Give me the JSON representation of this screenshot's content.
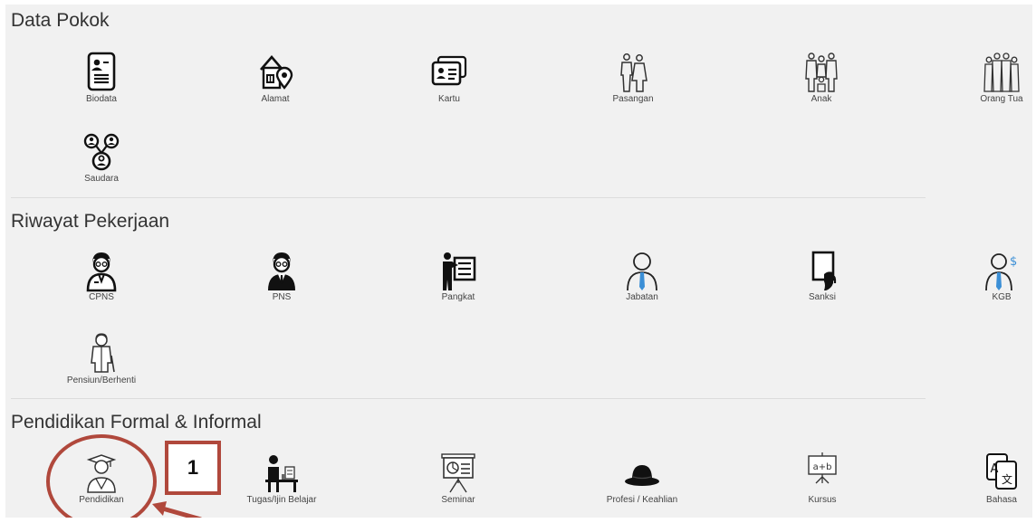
{
  "sections": [
    {
      "title": "Data Pokok",
      "items": [
        {
          "label": "Biodata",
          "icon": "id-card-icon"
        },
        {
          "label": "Alamat",
          "icon": "house-location-icon"
        },
        {
          "label": "Kartu",
          "icon": "card-icon"
        },
        {
          "label": "Pasangan",
          "icon": "couple-icon"
        },
        {
          "label": "Anak",
          "icon": "family-children-icon"
        },
        {
          "label": "Orang Tua",
          "icon": "parents-family-icon"
        },
        {
          "label": "Saudara",
          "icon": "siblings-network-icon"
        }
      ]
    },
    {
      "title": "Riwayat Pekerjaan",
      "items": [
        {
          "label": "CPNS",
          "icon": "civil-servant-candidate-icon"
        },
        {
          "label": "PNS",
          "icon": "civil-servant-icon"
        },
        {
          "label": "Pangkat",
          "icon": "presenter-board-icon"
        },
        {
          "label": "Jabatan",
          "icon": "person-tie-icon"
        },
        {
          "label": "Sanksi",
          "icon": "red-card-hand-icon"
        },
        {
          "label": "KGB",
          "icon": "person-salary-icon"
        },
        {
          "label": "Pensiun/Berhenti",
          "icon": "elderly-man-icon"
        }
      ]
    },
    {
      "title": "Pendidikan Formal & Informal",
      "items": [
        {
          "label": "Pendidikan",
          "icon": "graduate-icon"
        },
        {
          "label": "Tugas/Ijin Belajar",
          "icon": "student-desk-icon"
        },
        {
          "label": "Seminar",
          "icon": "presentation-board-icon"
        },
        {
          "label": "Profesi / Keahlian",
          "icon": "hat-icon"
        },
        {
          "label": "Kursus",
          "icon": "math-board-icon"
        },
        {
          "label": "Bahasa",
          "icon": "translate-icon"
        }
      ]
    }
  ],
  "annotation": {
    "callout_number": "1",
    "color": "#b0483c"
  }
}
